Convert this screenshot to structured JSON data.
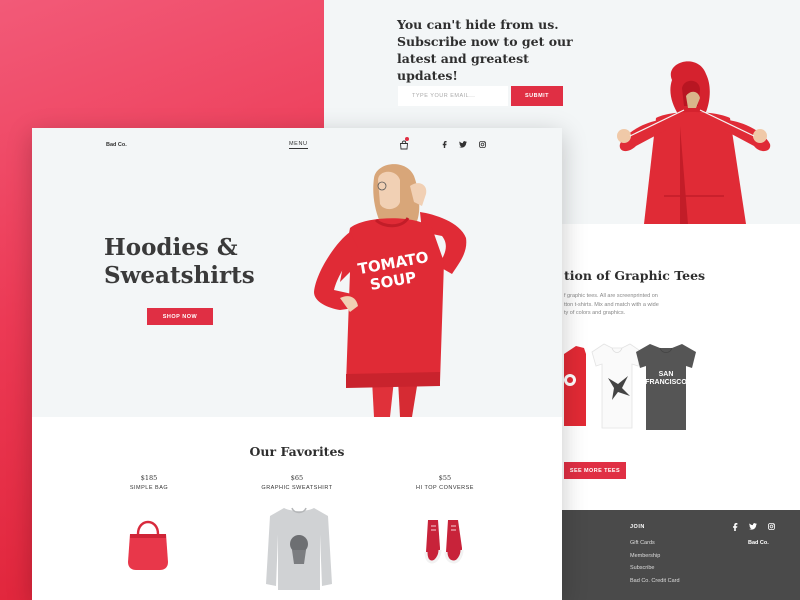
{
  "subscribe": {
    "line1": "You can't hide from us.",
    "line2": "Subscribe now to get our",
    "line3": "latest and greatest updates!",
    "email_placeholder": "TYPE YOUR EMAIL...",
    "submit_label": "SUBMIT"
  },
  "tees": {
    "title": "tion of Graphic Tees",
    "desc_line1": "f graphic tees.  All are screenprinted on",
    "desc_line2": "tton t-shirts.  Mix and match with a wide",
    "desc_line3": "ty of colors and graphics.",
    "tee_text_line1": "SAN",
    "tee_text_line2": "FRANCISCO",
    "button_label": "SEE MORE TEES"
  },
  "footer": {
    "join_label": "JOIN",
    "links": [
      "Gift Cards",
      "Membership",
      "Subscribe",
      "Bad Co. Credit Card"
    ],
    "brand": "Bad Co.",
    "social_icons": [
      "facebook-icon",
      "twitter-icon",
      "instagram-icon"
    ]
  },
  "nav": {
    "brand": "Bad Co.",
    "menu_label": "MENU",
    "social_icons": [
      "facebook-icon",
      "twitter-icon",
      "instagram-icon"
    ]
  },
  "hero": {
    "title_line1": "Hoodies &",
    "title_line2": "Sweatshirts",
    "shop_label": "SHOP NOW",
    "shirt_text_line1": "TOMATO",
    "shirt_text_line2": "SOUP"
  },
  "favorites": {
    "title": "Our Favorites",
    "products": [
      {
        "price": "$185",
        "name": "SIMPLE BAG"
      },
      {
        "price": "$65",
        "name": "GRAPHIC SWEATSHIRT"
      },
      {
        "price": "$55",
        "name": "HI TOP CONVERSE"
      }
    ]
  },
  "colors": {
    "accent": "#e02f44",
    "gradient_top": "#f25a78",
    "gradient_bottom": "#dd1f33",
    "hero_bg": "#f3f6f7",
    "footer_bg": "#4a4a4a"
  }
}
